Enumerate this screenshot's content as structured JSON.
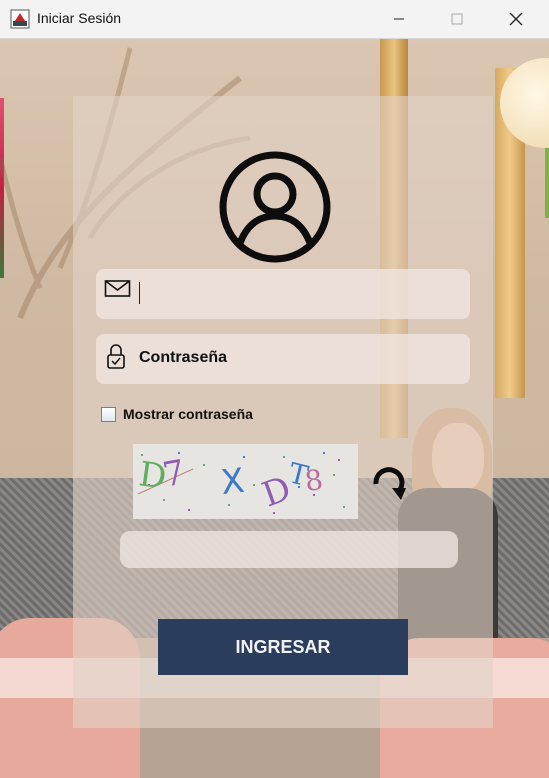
{
  "window": {
    "title": "Iniciar Sesión",
    "controls": {
      "minimize_icon": "minimize-icon",
      "maximize_icon": "maximize-icon",
      "close_icon": "close-icon"
    }
  },
  "login": {
    "avatar_icon": "user-circle-icon",
    "email": {
      "icon": "envelope-icon",
      "value": ""
    },
    "password": {
      "icon": "lock-icon",
      "placeholder": "Contraseña"
    },
    "show_password": {
      "label": "Mostrar contraseña",
      "checked": false
    },
    "captcha": {
      "text": "D7XDT8",
      "refresh_icon": "refresh-icon"
    },
    "captcha_input": {
      "value": ""
    },
    "submit_label": "INGRESAR"
  },
  "colors": {
    "button_bg": "#2b3d5c",
    "button_text": "#f2f2f2",
    "panel_overlay": "#e2d2c6"
  }
}
